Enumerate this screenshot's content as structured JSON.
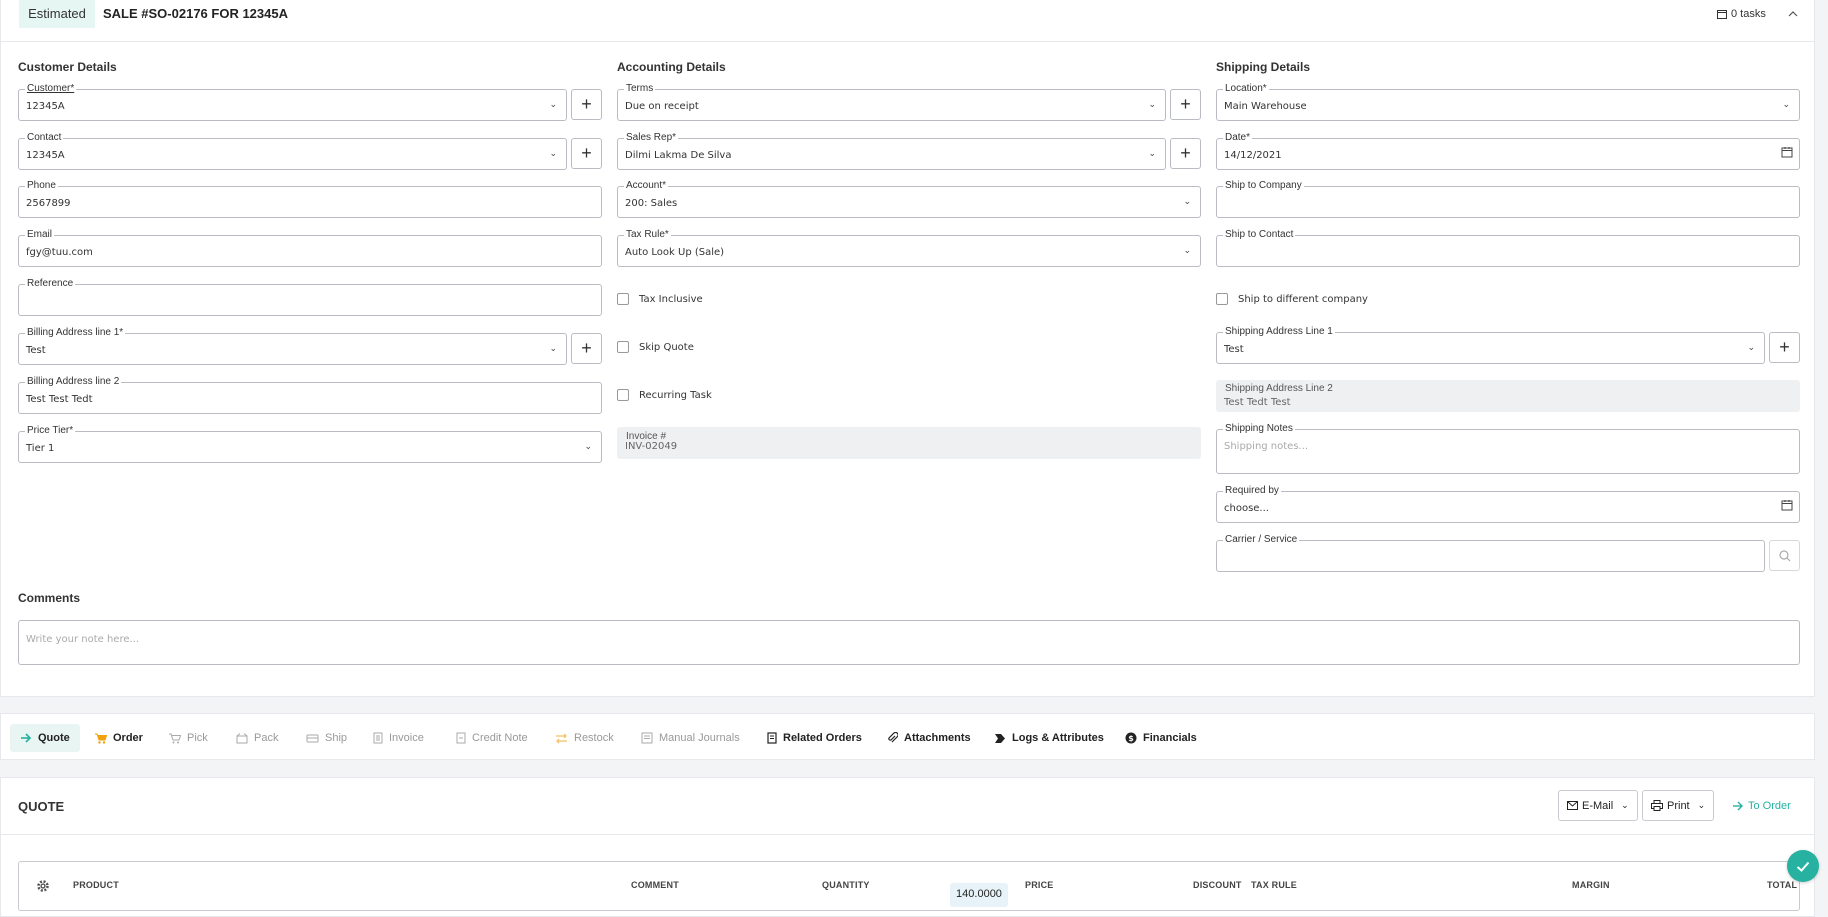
{
  "header": {
    "status_badge": "Estimated",
    "title": "SALE #SO-02176 FOR 12345A",
    "tasks": "0 tasks"
  },
  "customer": {
    "section_title": "Customer Details",
    "customer": {
      "label": "Customer*",
      "value": "12345A"
    },
    "contact": {
      "label": "Contact",
      "value": "12345A"
    },
    "phone": {
      "label": "Phone",
      "value": "2567899"
    },
    "email": {
      "label": "Email",
      "value": "fgy@tuu.com"
    },
    "reference": {
      "label": "Reference",
      "value": ""
    },
    "billing1": {
      "label": "Billing Address line 1*",
      "value": "Test"
    },
    "billing2": {
      "label": "Billing Address line 2",
      "value": "Test Test  Tedt"
    },
    "price_tier": {
      "label": "Price Tier*",
      "value": "Tier 1"
    }
  },
  "accounting": {
    "section_title": "Accounting Details",
    "terms": {
      "label": "Terms",
      "value": "Due on receipt"
    },
    "sales_rep": {
      "label": "Sales Rep*",
      "value": "Dilmi Lakma De Silva"
    },
    "account": {
      "label": "Account*",
      "value": "200: Sales"
    },
    "tax_rule": {
      "label": "Tax Rule*",
      "value": "Auto Look Up (Sale)"
    },
    "tax_inclusive": "Tax Inclusive",
    "skip_quote": "Skip Quote",
    "recurring_task": "Recurring Task",
    "invoice": {
      "label": "Invoice #",
      "value": "INV-02049"
    }
  },
  "shipping": {
    "section_title": "Shipping Details",
    "location": {
      "label": "Location*",
      "value": "Main Warehouse"
    },
    "date": {
      "label": "Date*",
      "value": "14/12/2021"
    },
    "ship_company": {
      "label": "Ship to Company",
      "value": ""
    },
    "ship_contact": {
      "label": "Ship to Contact",
      "value": ""
    },
    "ship_different": "Ship to different company",
    "address1": {
      "label": "Shipping Address Line 1",
      "value": "Test"
    },
    "address2": {
      "label": "Shipping Address Line 2",
      "value": "Test Tedt  Test"
    },
    "notes": {
      "label": "Shipping Notes",
      "placeholder": "Shipping notes..."
    },
    "required_by": {
      "label": "Required by",
      "placeholder": "choose..."
    },
    "carrier": {
      "label": "Carrier / Service",
      "value": ""
    }
  },
  "comments": {
    "title": "Comments",
    "placeholder": "Write your note here..."
  },
  "tabs": [
    {
      "label": "Quote",
      "icon": "arrow-right-icon",
      "color": "#26b1a1"
    },
    {
      "label": "Order",
      "icon": "cart-icon",
      "color": "#f2a20c"
    },
    {
      "label": "Pick",
      "icon": "cart-outline-icon"
    },
    {
      "label": "Pack",
      "icon": "box-icon"
    },
    {
      "label": "Ship",
      "icon": "truck-icon"
    },
    {
      "label": "Invoice",
      "icon": "document-icon"
    },
    {
      "label": "Credit Note",
      "icon": "document-icon"
    },
    {
      "label": "Restock",
      "icon": "swap-icon",
      "color": "#f2a20c"
    },
    {
      "label": "Manual Journals",
      "icon": "journal-icon"
    },
    {
      "label": "Related Orders",
      "icon": "related-icon"
    },
    {
      "label": "Attachments",
      "icon": "paperclip-icon"
    },
    {
      "label": "Logs & Attributes",
      "icon": "tag-icon"
    },
    {
      "label": "Financials",
      "icon": "dollar-icon"
    }
  ],
  "quote": {
    "title": "QUOTE",
    "email_btn": "E-Mail",
    "print_btn": "Print",
    "to_order": "To Order",
    "columns": {
      "product": "PRODUCT",
      "comment": "COMMENT",
      "quantity": "QUANTITY",
      "price": "PRICE",
      "discount": "DISCOUNT",
      "tax_rule": "TAX RULE",
      "margin": "MARGIN",
      "total": "TOTAL"
    },
    "quantity_value": "140.0000"
  },
  "colors": {
    "accent": "#26b1a1",
    "badge_bg": "#e6f6f3"
  }
}
